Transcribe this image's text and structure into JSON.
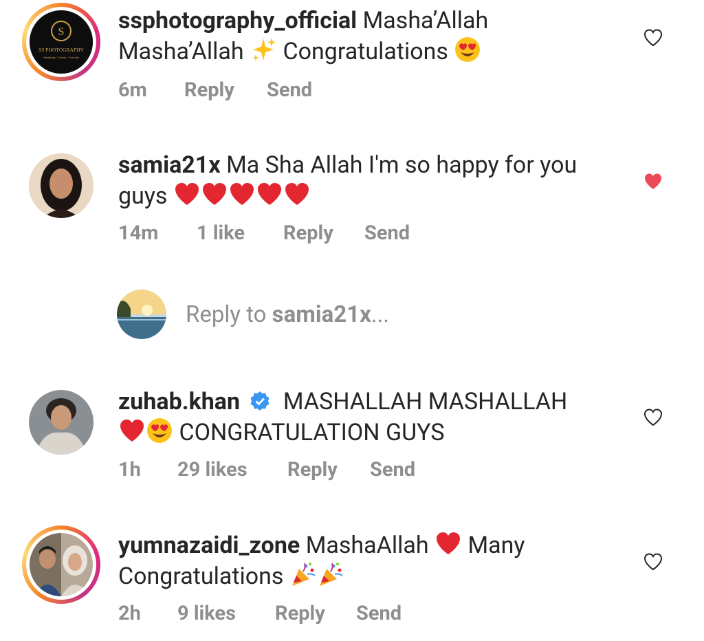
{
  "comments": [
    {
      "username": "ssphotography_official",
      "text_line1": "Masha’Allah",
      "text_line2a": "Masha’Allah",
      "text_line2b": "Congratulations",
      "emoji_1": "sparkles",
      "emoji_2": "heart-eyes",
      "avatar_text_main": "SS PHOTOGRAPHY",
      "avatar_text_sub": "Weddings · Events · Portraits",
      "time": "6m",
      "reply_label": "Reply",
      "send_label": "Send",
      "liked": false
    },
    {
      "username": "samia21x",
      "text_line1": "Ma Sha Allah I'm so happy for you",
      "text_line2": "guys",
      "emoji_1": "red-heart",
      "emoji_count": 5,
      "time": "14m",
      "likes": "1 like",
      "reply_label": "Reply",
      "send_label": "Send",
      "liked": true
    },
    {
      "username": "zuhab.khan",
      "verified": true,
      "text_line1": "MASHALLAH MASHALLAH",
      "text_line2": "CONGRATULATION GUYS",
      "emoji_1": "red-heart",
      "emoji_2": "heart-eyes",
      "time": "1h",
      "likes": "29 likes",
      "reply_label": "Reply",
      "send_label": "Send",
      "liked": false
    },
    {
      "username": "yumnazaidi_zone",
      "text_line1a": "MashaAllah",
      "text_line1b": "Many",
      "text_line2": "Congratulations",
      "emoji_1": "red-heart",
      "emoji_2": "party-popper",
      "time": "2h",
      "likes": "9 likes",
      "reply_label": "Reply",
      "send_label": "Send",
      "liked": false
    }
  ],
  "reply_to": {
    "prefix": "Reply to",
    "username": "samia21x",
    "suffix": "..."
  },
  "colors": {
    "text": "#262626",
    "secondary": "#8e8e8e",
    "like_red": "#ed4956",
    "verified_blue": "#3897f0"
  }
}
